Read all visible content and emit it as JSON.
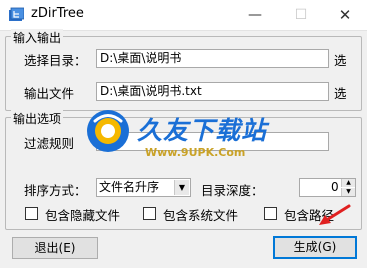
{
  "window": {
    "title": "zDirTree",
    "minimize": "—",
    "maximize": "☐",
    "close": "✕"
  },
  "io_group": {
    "title": "输入输出",
    "dir_label": "选择目录：",
    "dir_value": "D:\\桌面\\说明书",
    "dir_select": "选",
    "out_label": "输出文件",
    "out_value": "D:\\桌面\\说明书.txt",
    "out_select": "选"
  },
  "opt_group": {
    "title": "输出选项",
    "filter_label": "过滤规则",
    "sort_label": "排序方式：",
    "sort_value": "文件名升序",
    "depth_label": "目录深度：",
    "depth_value": "0",
    "cb_hidden": "包含隐藏文件",
    "cb_system": "包含系统文件",
    "cb_path": "包含路径"
  },
  "buttons": {
    "exit": "退出(E)",
    "generate": "生成(G)"
  },
  "watermark": {
    "name": "久友下载站",
    "url": "Www.9UPK.Com"
  },
  "colors": {
    "accent": "#0078d7",
    "arrow": "#e02020",
    "logo_blue": "#1a6fd6",
    "logo_yellow": "#f5b800"
  }
}
